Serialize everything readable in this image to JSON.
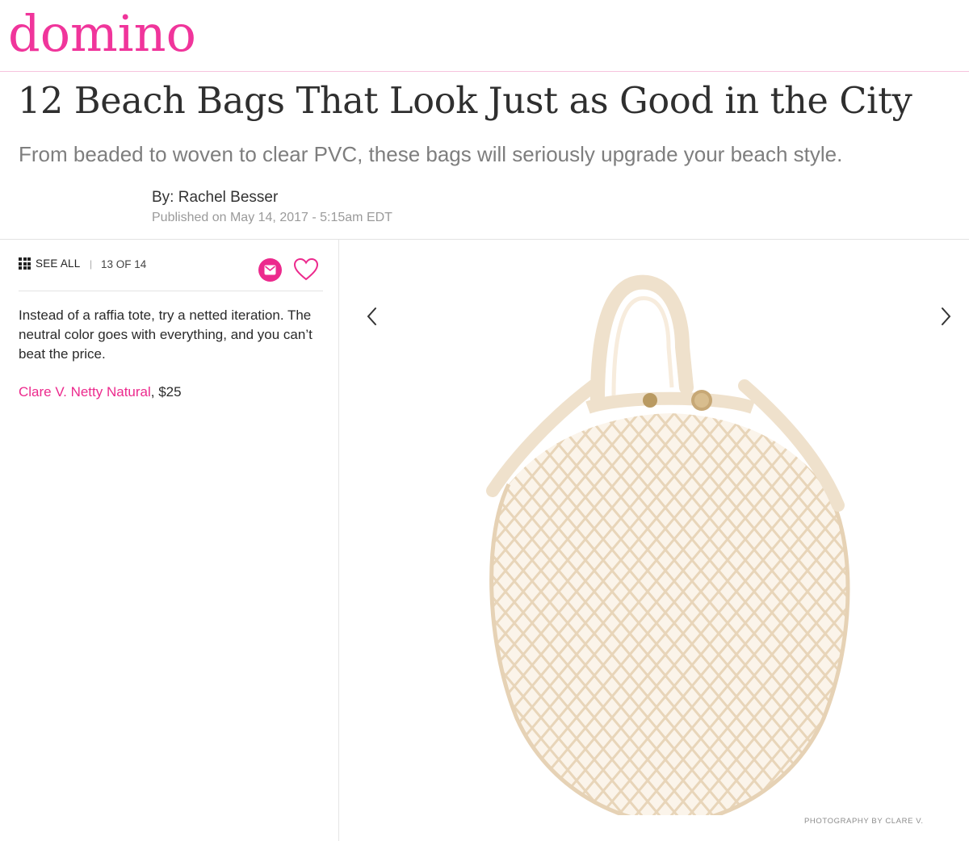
{
  "site": {
    "logo": "domino",
    "brand_color": "#f0359b"
  },
  "article": {
    "title": "12 Beach Bags That Look Just as Good in the City",
    "dek": "From beaded to woven to clear PVC, these bags will seriously upgrade your beach style.",
    "byline": "By: Rachel Besser",
    "published": "Published on May 14, 2017 - 5:15am EDT"
  },
  "gallery": {
    "see_all_label": "SEE ALL",
    "separator": "|",
    "counter": "13 OF 14",
    "icons": {
      "grid": "grid-icon",
      "email": "email-icon",
      "favorite": "heart-icon",
      "previous": "chevron-left-icon",
      "next": "chevron-right-icon"
    },
    "caption": "Instead of a raffia tote, try a netted iteration. The neutral color goes with everything, and you can’t beat the price.",
    "product": {
      "name": "Clare V. Netty Natural",
      "price_suffix": ", $25"
    },
    "photo_credit": "PHOTOGRAPHY BY CLARE V.",
    "accent_color": "#ec2a8d"
  }
}
